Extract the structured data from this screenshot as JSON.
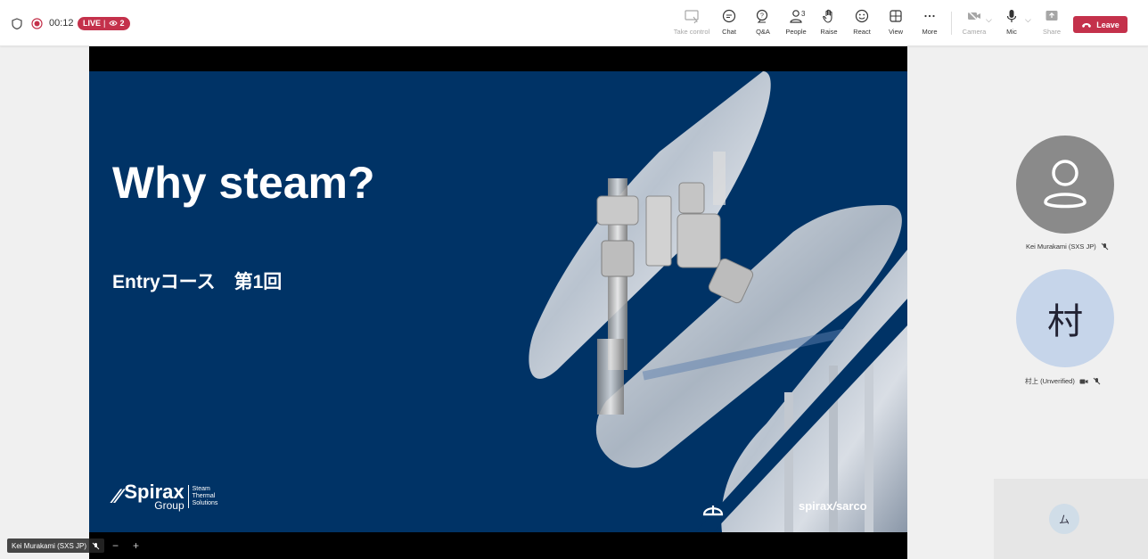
{
  "meeting": {
    "timer": "00:12",
    "live_label": "LIVE",
    "viewer_count": "2"
  },
  "toolbar": {
    "take_control": "Take control",
    "chat": "Chat",
    "qa": "Q&A",
    "people": "People",
    "people_count": "3",
    "raise": "Raise",
    "react": "React",
    "view": "View",
    "more": "More",
    "camera": "Camera",
    "mic": "Mic",
    "share": "Share",
    "leave": "Leave"
  },
  "slide": {
    "title": "Why steam?",
    "subtitle": "Entryコース　第1回",
    "logo_left_main": "Spirax",
    "logo_left_group": "Group",
    "logo_left_tag1": "Steam",
    "logo_left_tag2": "Thermal",
    "logo_left_tag3": "Solutions",
    "logo_right_1": "spirax",
    "logo_right_2": "sarco"
  },
  "presenter": {
    "name": "Kei Murakami (SXS JP)"
  },
  "participants": [
    {
      "name": "Kei Murakami (SXS JP)",
      "avatar": "person-icon"
    },
    {
      "name": "村上 (Unverified)",
      "initial": "村"
    }
  ],
  "self": {
    "initial": "ム"
  },
  "colors": {
    "slide_bg": "#003366",
    "leave": "#c4314b",
    "live": "#c4314b"
  }
}
